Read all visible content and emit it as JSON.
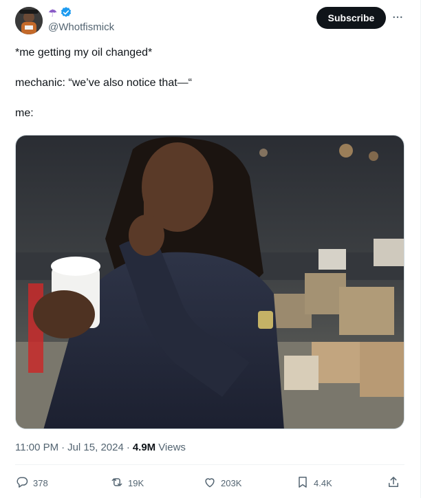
{
  "user": {
    "handle": "@Whotfismick",
    "emoji": "☂",
    "verified_color": "#1d9bf0"
  },
  "header": {
    "subscribe_label": "Subscribe",
    "more_label": "···"
  },
  "tweet": {
    "lines": [
      "*me getting my oil changed*",
      "mechanic: “we’ve also notice that—“",
      "me:"
    ]
  },
  "meta": {
    "time": "11:00 PM",
    "sep1": "·",
    "date": "Jul 15, 2024",
    "sep2": "·",
    "views_count": "4.9M",
    "views_label": "Views"
  },
  "actions": {
    "replies": "378",
    "reposts": "19K",
    "likes": "203K",
    "bookmarks": "4.4K"
  },
  "icons": {
    "reply": "reply-icon",
    "repost": "repost-icon",
    "like": "heart-icon",
    "bookmark": "bookmark-icon",
    "share": "share-icon",
    "verified": "verified-badge-icon",
    "umbrella": "umbrella-icon"
  },
  "colors": {
    "text_primary": "#0f1419",
    "text_secondary": "#536471",
    "button_dark": "#0f1419",
    "verified": "#1d9bf0"
  }
}
